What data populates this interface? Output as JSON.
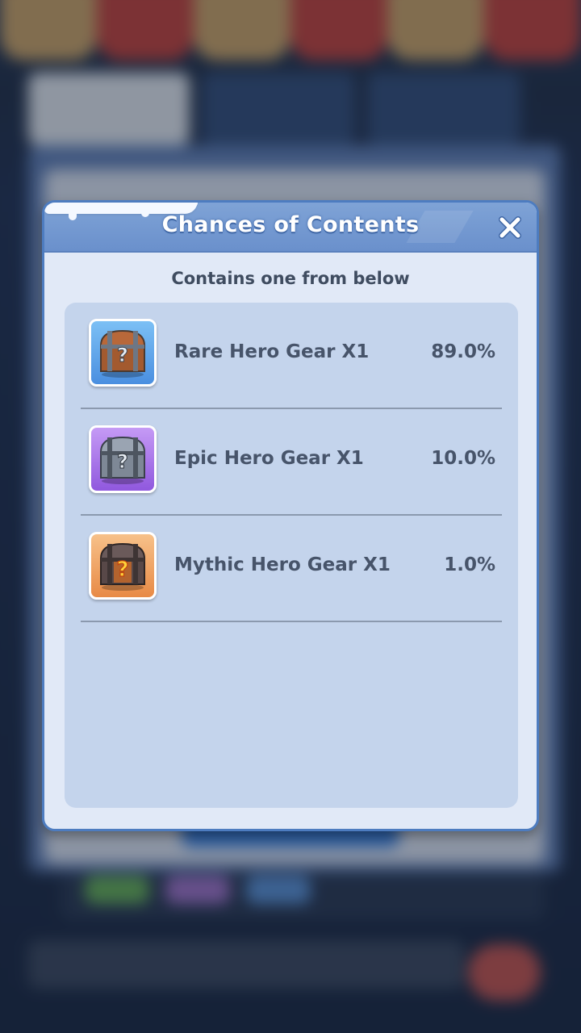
{
  "dialog": {
    "title": "Chances of Contents",
    "subtitle": "Contains one from below",
    "close_icon": "close-icon"
  },
  "items": [
    {
      "name": "Rare Hero Gear X1",
      "chance": "89.0%",
      "icon": "rare-chest-icon",
      "frame_color": "#5aa2e6"
    },
    {
      "name": "Epic Hero Gear X1",
      "chance": "10.0%",
      "icon": "epic-chest-icon",
      "frame_color": "#a86ee6"
    },
    {
      "name": "Mythic Hero Gear X1",
      "chance": "1.0%",
      "icon": "mythic-chest-icon",
      "frame_color": "#f0a25a"
    }
  ],
  "colors": {
    "header": "#6a90cc",
    "panel": "#e1e9f7",
    "list_bg": "#c4d4ec",
    "text": "#47546a"
  }
}
